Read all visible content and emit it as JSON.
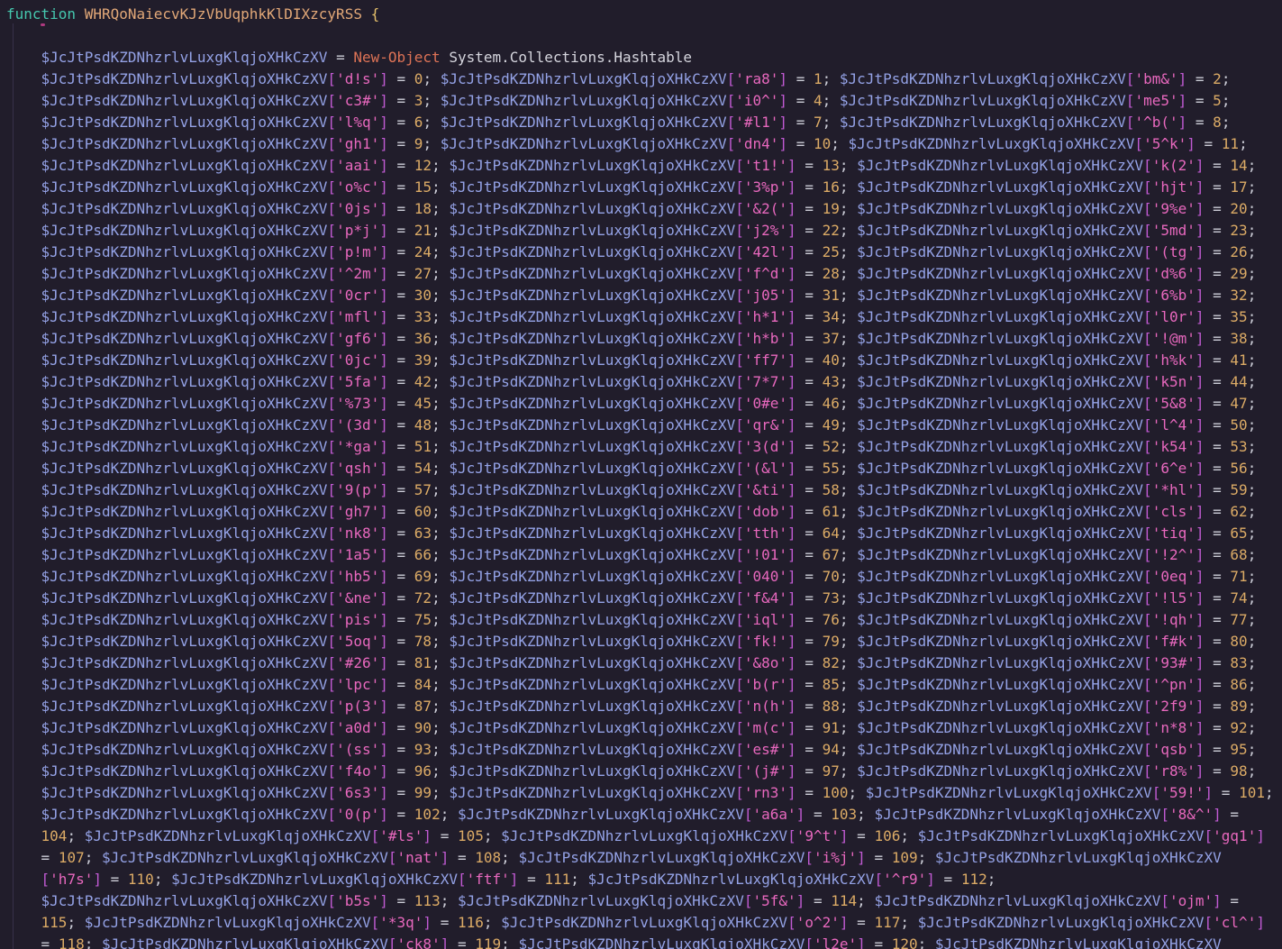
{
  "editor": {
    "language": "powershell",
    "function_keyword": "function",
    "function_name": "WHRQoNaiecvKJzVbUqphkKlDIXzcyRSS",
    "open_brace": "{",
    "indent": "    ",
    "variable": "$JcJtPsdKZDNhzrlvLuxgKlqjoXHkCzXV",
    "assignment_operator": "=",
    "cmdlet": "New-Object",
    "type_name": "System.Collections.Hashtable",
    "var_placeholder": "§",
    "hashtable_keys_in_order": [
      "d!s",
      "ra8",
      "bm&",
      "c3#",
      "i0^",
      "me5",
      "l%q",
      "#l1",
      "^b(",
      "gh1",
      "dn4",
      "5^k",
      "aai",
      "t1!",
      "k(2",
      "o%c",
      "3%p",
      "hjt",
      "0js",
      "&2(",
      "9%e",
      "p*j",
      "j2%",
      "5md",
      "p!m",
      "42l",
      "(tg",
      "^2m",
      "f^d",
      "d%6",
      "0cr",
      "j05",
      "6%b",
      "mfl",
      "h*1",
      "l0r",
      "gf6",
      "h*b",
      "!@m",
      "0jc",
      "ff7",
      "h%k",
      "5fa",
      "7*7",
      "k5n",
      "%73",
      "0#e",
      "5&8",
      "(3d",
      "qr&",
      "l^4",
      "*ga",
      "3(d",
      "k54",
      "qsh",
      "(&l",
      "6^e",
      "9(p",
      "&ti",
      "*hl",
      "gh7",
      "dob",
      "cls",
      "nk8",
      "tth",
      "tiq",
      "1a5",
      "!01",
      "!2^",
      "hb5",
      "040",
      "0eq",
      "&ne",
      "f&4",
      "!l5",
      "pis",
      "iql",
      "!qh",
      "5oq",
      "fk!",
      "f#k",
      "#26",
      "&8o",
      "93#",
      "lpc",
      "b(r",
      "^pn",
      "p(3",
      "n(h",
      "2f9",
      "a0d",
      "m(c",
      "n*8",
      "(ss",
      "es#",
      "qsb",
      "f4o",
      "(j#",
      "r8%",
      "6s3",
      "rn3",
      "59!",
      "0(p",
      "a6a",
      "8&^",
      "#ls",
      "9^t",
      "gq1",
      "nat",
      "i%j",
      "h7s",
      "ftf",
      "^r9",
      "b5s",
      "5f&",
      "ojm",
      "*3q",
      "o^2",
      "cl^",
      "ck8",
      "l2e"
    ],
    "hashtable_values_note": "value equals key index 0..120",
    "rows": [
      "§['d!s'] = 0; §['ra8'] = 1; §['bm&'] = 2;",
      "§['c3#'] = 3; §['i0^'] = 4; §['me5'] = 5;",
      "§['l%q'] = 6; §['#l1'] = 7; §['^b('] = 8;",
      "§['gh1'] = 9; §['dn4'] = 10; §['5^k'] = 11;",
      "§['aai'] = 12; §['t1!'] = 13; §['k(2'] = 14;",
      "§['o%c'] = 15; §['3%p'] = 16; §['hjt'] = 17;",
      "§['0js'] = 18; §['&2('] = 19; §['9%e'] = 20;",
      "§['p*j'] = 21; §['j2%'] = 22; §['5md'] = 23;",
      "§['p!m'] = 24; §['42l'] = 25; §['(tg'] = 26;",
      "§['^2m'] = 27; §['f^d'] = 28; §['d%6'] = 29;",
      "§['0cr'] = 30; §['j05'] = 31; §['6%b'] = 32;",
      "§['mfl'] = 33; §['h*1'] = 34; §['l0r'] = 35;",
      "§['gf6'] = 36; §['h*b'] = 37; §['!@m'] = 38;",
      "§['0jc'] = 39; §['ff7'] = 40; §['h%k'] = 41;",
      "§['5fa'] = 42; §['7*7'] = 43; §['k5n'] = 44;",
      "§['%73'] = 45; §['0#e'] = 46; §['5&8'] = 47;",
      "§['(3d'] = 48; §['qr&'] = 49; §['l^4'] = 50;",
      "§['*ga'] = 51; §['3(d'] = 52; §['k54'] = 53;",
      "§['qsh'] = 54; §['(&l'] = 55; §['6^e'] = 56;",
      "§['9(p'] = 57; §['&ti'] = 58; §['*hl'] = 59;",
      "§['gh7'] = 60; §['dob'] = 61; §['cls'] = 62;",
      "§['nk8'] = 63; §['tth'] = 64; §['tiq'] = 65;",
      "§['1a5'] = 66; §['!01'] = 67; §['!2^'] = 68;",
      "§['hb5'] = 69; §['040'] = 70; §['0eq'] = 71;",
      "§['&ne'] = 72; §['f&4'] = 73; §['!l5'] = 74;",
      "§['pis'] = 75; §['iql'] = 76; §['!qh'] = 77;",
      "§['5oq'] = 78; §['fk!'] = 79; §['f#k'] = 80;",
      "§['#26'] = 81; §['&8o'] = 82; §['93#'] = 83;",
      "§['lpc'] = 84; §['b(r'] = 85; §['^pn'] = 86;",
      "§['p(3'] = 87; §['n(h'] = 88; §['2f9'] = 89;",
      "§['a0d'] = 90; §['m(c'] = 91; §['n*8'] = 92;",
      "§['(ss'] = 93; §['es#'] = 94; §['qsb'] = 95;",
      "§['f4o'] = 96; §['(j#'] = 97; §['r8%'] = 98;",
      "§['6s3'] = 99; §['rn3'] = 100; §['59!'] = 101;",
      "§['0(p'] = 102; §['a6a'] = 103; §['8&^'] =",
      "104; §['#ls'] = 105; §['9^t'] = 106; §['gq1']",
      "= 107; §['nat'] = 108; §['i%j'] = 109; §",
      "['h7s'] = 110; §['ftf'] = 111; §['^r9'] = 112;",
      "§['b5s'] = 113; §['5f&'] = 114; §['ojm'] =",
      "115; §['*3q'] = 116; §['o^2'] = 117; §['cl^']",
      "= 118; §['ck8'] = 119; §['l2e'] = 120; §"
    ]
  },
  "colors": {
    "background": "#211d2b",
    "keyword": "#45c7ae",
    "function_name": "#e2a878",
    "brace": "#e5c06b",
    "variable": "#94a2e6",
    "bracket": "#c05ad2",
    "string": "#e868be",
    "number": "#dcab66",
    "punctuation": "#cdced8",
    "cmdlet": "#de7356",
    "type_name": "#d6d6de"
  }
}
